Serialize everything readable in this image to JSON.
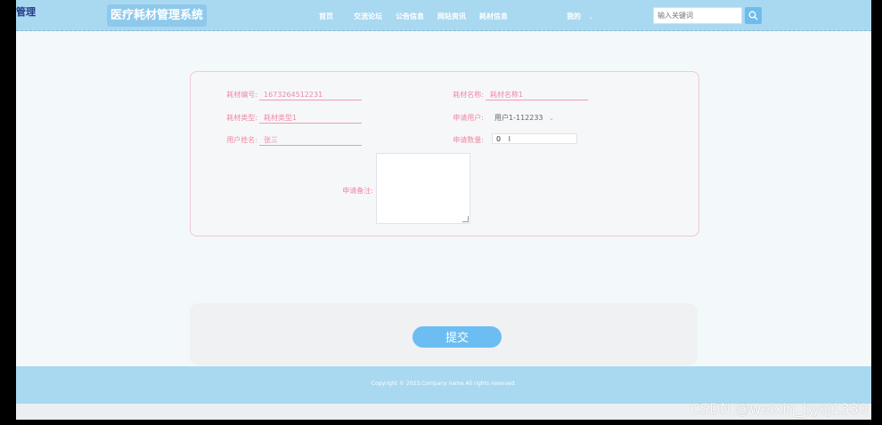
{
  "header": {
    "corner_logo": "管理",
    "brand": "医疗耗材管理系统",
    "nav": [
      "首页",
      "交流论坛",
      "公告信息",
      "网站资讯",
      "耗材信息",
      "我的"
    ],
    "search_placeholder": "输入关键词"
  },
  "form": {
    "labels": {
      "code": "耗材编号:",
      "name": "耗材名称:",
      "type": "耗材类型:",
      "user": "申请用户:",
      "username": "用户姓名:",
      "quantity": "申请数量:",
      "remark": "申请备注:"
    },
    "values": {
      "code": "1673264512231",
      "name": "耗材名称1",
      "type": "耗材类型1",
      "user": "用户1-112233",
      "username": "张三",
      "quantity": "0"
    }
  },
  "submit": "提交",
  "footer": {
    "copyright": "Copyright © 2023.Company name All rights reserved."
  },
  "watermark": "CSDN @weixin_bysj1330",
  "colors": {
    "header": "#a9d8f1",
    "accent": "#6cbdf1",
    "label": "#ee8aa5"
  }
}
